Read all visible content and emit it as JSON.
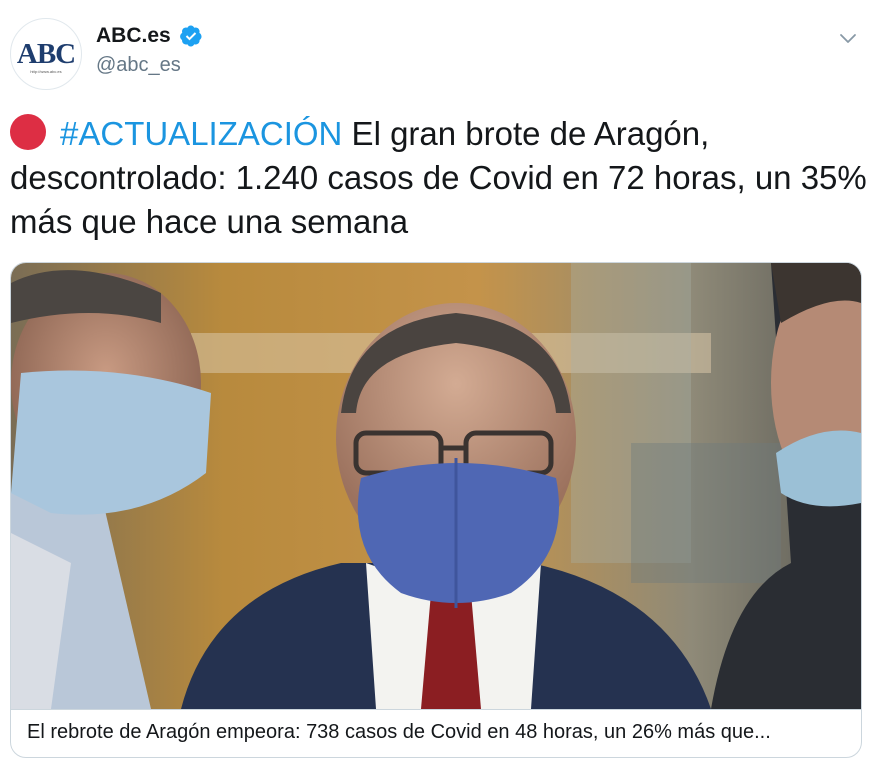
{
  "account": {
    "avatar_logo": "ABC",
    "avatar_subtext": "http://www.abc.es",
    "display_name": "ABC.es",
    "handle": "@abc_es",
    "verified": true,
    "verified_color": "#1da1f2"
  },
  "tweet": {
    "emoji": "red-circle",
    "hashtag": "#ACTUALIZACIÓN",
    "text": " El gran brote de Aragón, descontrolado: 1.240 casos de Covid en 72 horas, un 35% más que hace una semana"
  },
  "card": {
    "image_description_icon": "photo",
    "caption": "El rebrote de Aragón empeora: 738 casos de Covid en 48 horas, un 26% más que..."
  },
  "colors": {
    "link": "#1b95e0",
    "text": "#14171a",
    "secondary": "#657786",
    "border": "#ccd6dd",
    "red_circle": "#dd2e44"
  }
}
